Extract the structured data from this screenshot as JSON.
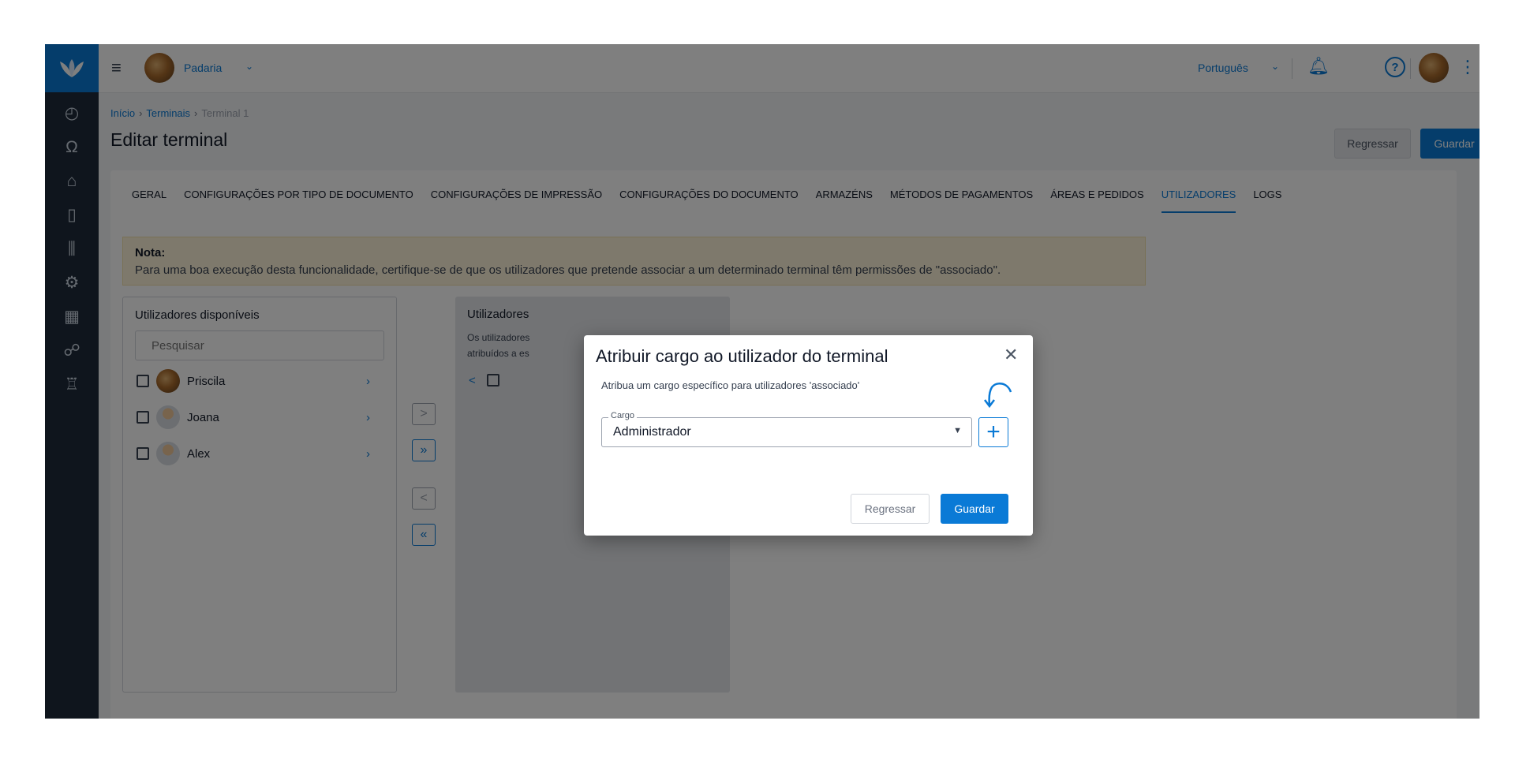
{
  "topbar": {
    "company": "Padaria",
    "language": "Português"
  },
  "breadcrumb": {
    "home": "Início",
    "terminals": "Terminais",
    "current": "Terminal 1"
  },
  "page": {
    "title": "Editar terminal",
    "back_label": "Regressar",
    "save_label": "Guardar"
  },
  "tabs": [
    {
      "label": "GERAL"
    },
    {
      "label": "CONFIGURAÇÕES POR TIPO DE DOCUMENTO"
    },
    {
      "label": "CONFIGURAÇÕES DE IMPRESSÃO"
    },
    {
      "label": "CONFIGURAÇÕES DO DOCUMENTO"
    },
    {
      "label": "ARMAZÉNS"
    },
    {
      "label": "MÉTODOS DE PAGAMENTOS"
    },
    {
      "label": "ÁREAS E PEDIDOS"
    },
    {
      "label": "UTILIZADORES"
    },
    {
      "label": "LOGS"
    }
  ],
  "active_tab": "UTILIZADORES",
  "note": {
    "title": "Nota:",
    "text": "Para uma boa execução desta funcionalidade, certifique-se de que os utilizadores que pretende associar a um determinado terminal têm permissões de \"associado\"."
  },
  "available": {
    "title": "Utilizadores disponíveis",
    "search_placeholder": "Pesquisar",
    "users": [
      {
        "name": "Priscila",
        "avatar": "food-photo"
      },
      {
        "name": "Joana",
        "avatar": "person-icon"
      },
      {
        "name": "Alex",
        "avatar": "person-icon"
      }
    ]
  },
  "move_buttons": {
    "move_right": ">",
    "move_all_right": "»",
    "move_left": "<",
    "move_all_left": "«"
  },
  "assigned": {
    "title": "Utilizadores",
    "desc_line1": "Os utilizadores",
    "desc_line2": "atribuídos a es",
    "row_chev": "<"
  },
  "modal": {
    "title": "Atribuir cargo ao utilizador do terminal",
    "subtitle": "Atribua um cargo específico para utilizadores 'associado'",
    "field_label": "Cargo",
    "field_value": "Administrador",
    "back_label": "Regressar",
    "save_label": "Guardar"
  },
  "colors": {
    "accent": "#0a7ad6",
    "sidebar": "#1e2a3b",
    "note_bg": "#fdf3d8"
  }
}
